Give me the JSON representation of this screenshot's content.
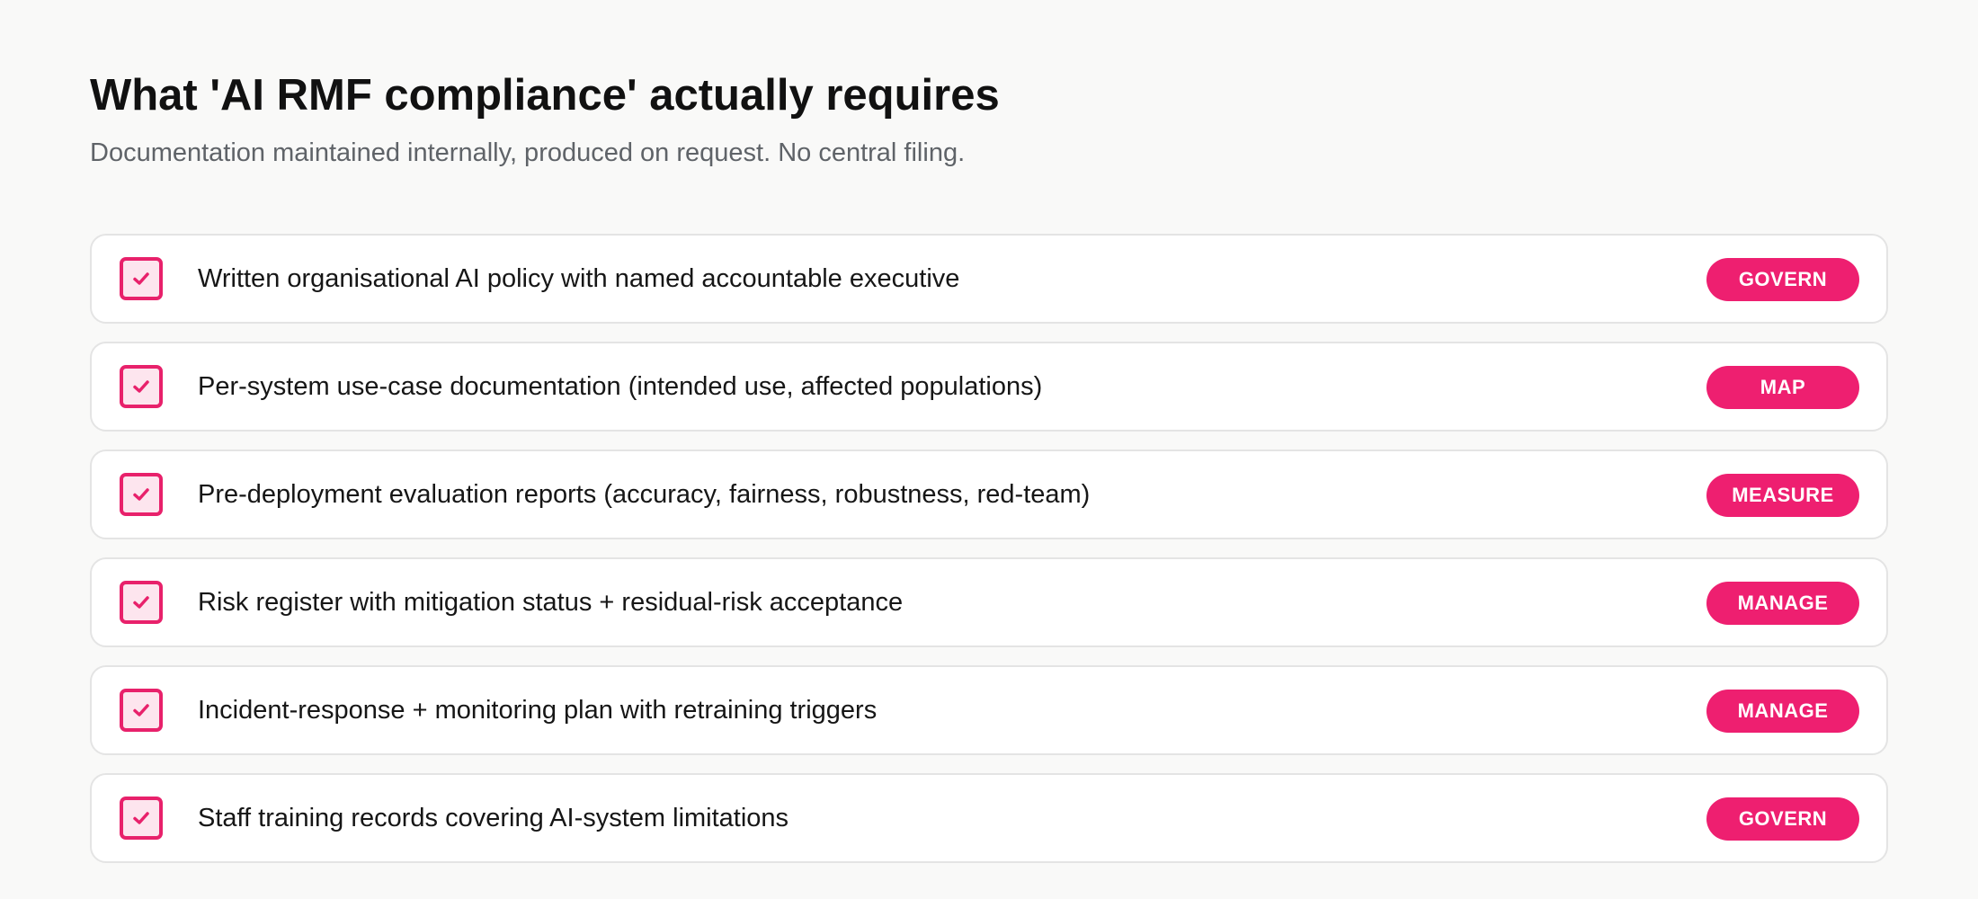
{
  "header": {
    "title": "What 'AI RMF compliance' actually requires",
    "subtitle": "Documentation maintained internally, produced on request. No central filing."
  },
  "items": [
    {
      "text": "Written organisational AI policy with named accountable executive",
      "tag": "GOVERN",
      "checked": true
    },
    {
      "text": "Per-system use-case documentation (intended use, affected populations)",
      "tag": "MAP",
      "checked": true
    },
    {
      "text": "Pre-deployment evaluation reports (accuracy, fairness, robustness, red-team)",
      "tag": "MEASURE",
      "checked": true
    },
    {
      "text": "Risk register with mitigation status + residual-risk acceptance",
      "tag": "MANAGE",
      "checked": true
    },
    {
      "text": "Incident-response + monitoring plan with retraining triggers",
      "tag": "MANAGE",
      "checked": true
    },
    {
      "text": "Staff training records covering AI-system limitations",
      "tag": "GOVERN",
      "checked": true
    }
  ],
  "icons": {
    "checkbox": "check-icon"
  },
  "colors": {
    "accent": "#ee1f70",
    "checkbox_fill": "#fde5ee",
    "background": "#f9f9f8",
    "card_border": "#e4e4e4",
    "subtitle": "#5f6368"
  }
}
